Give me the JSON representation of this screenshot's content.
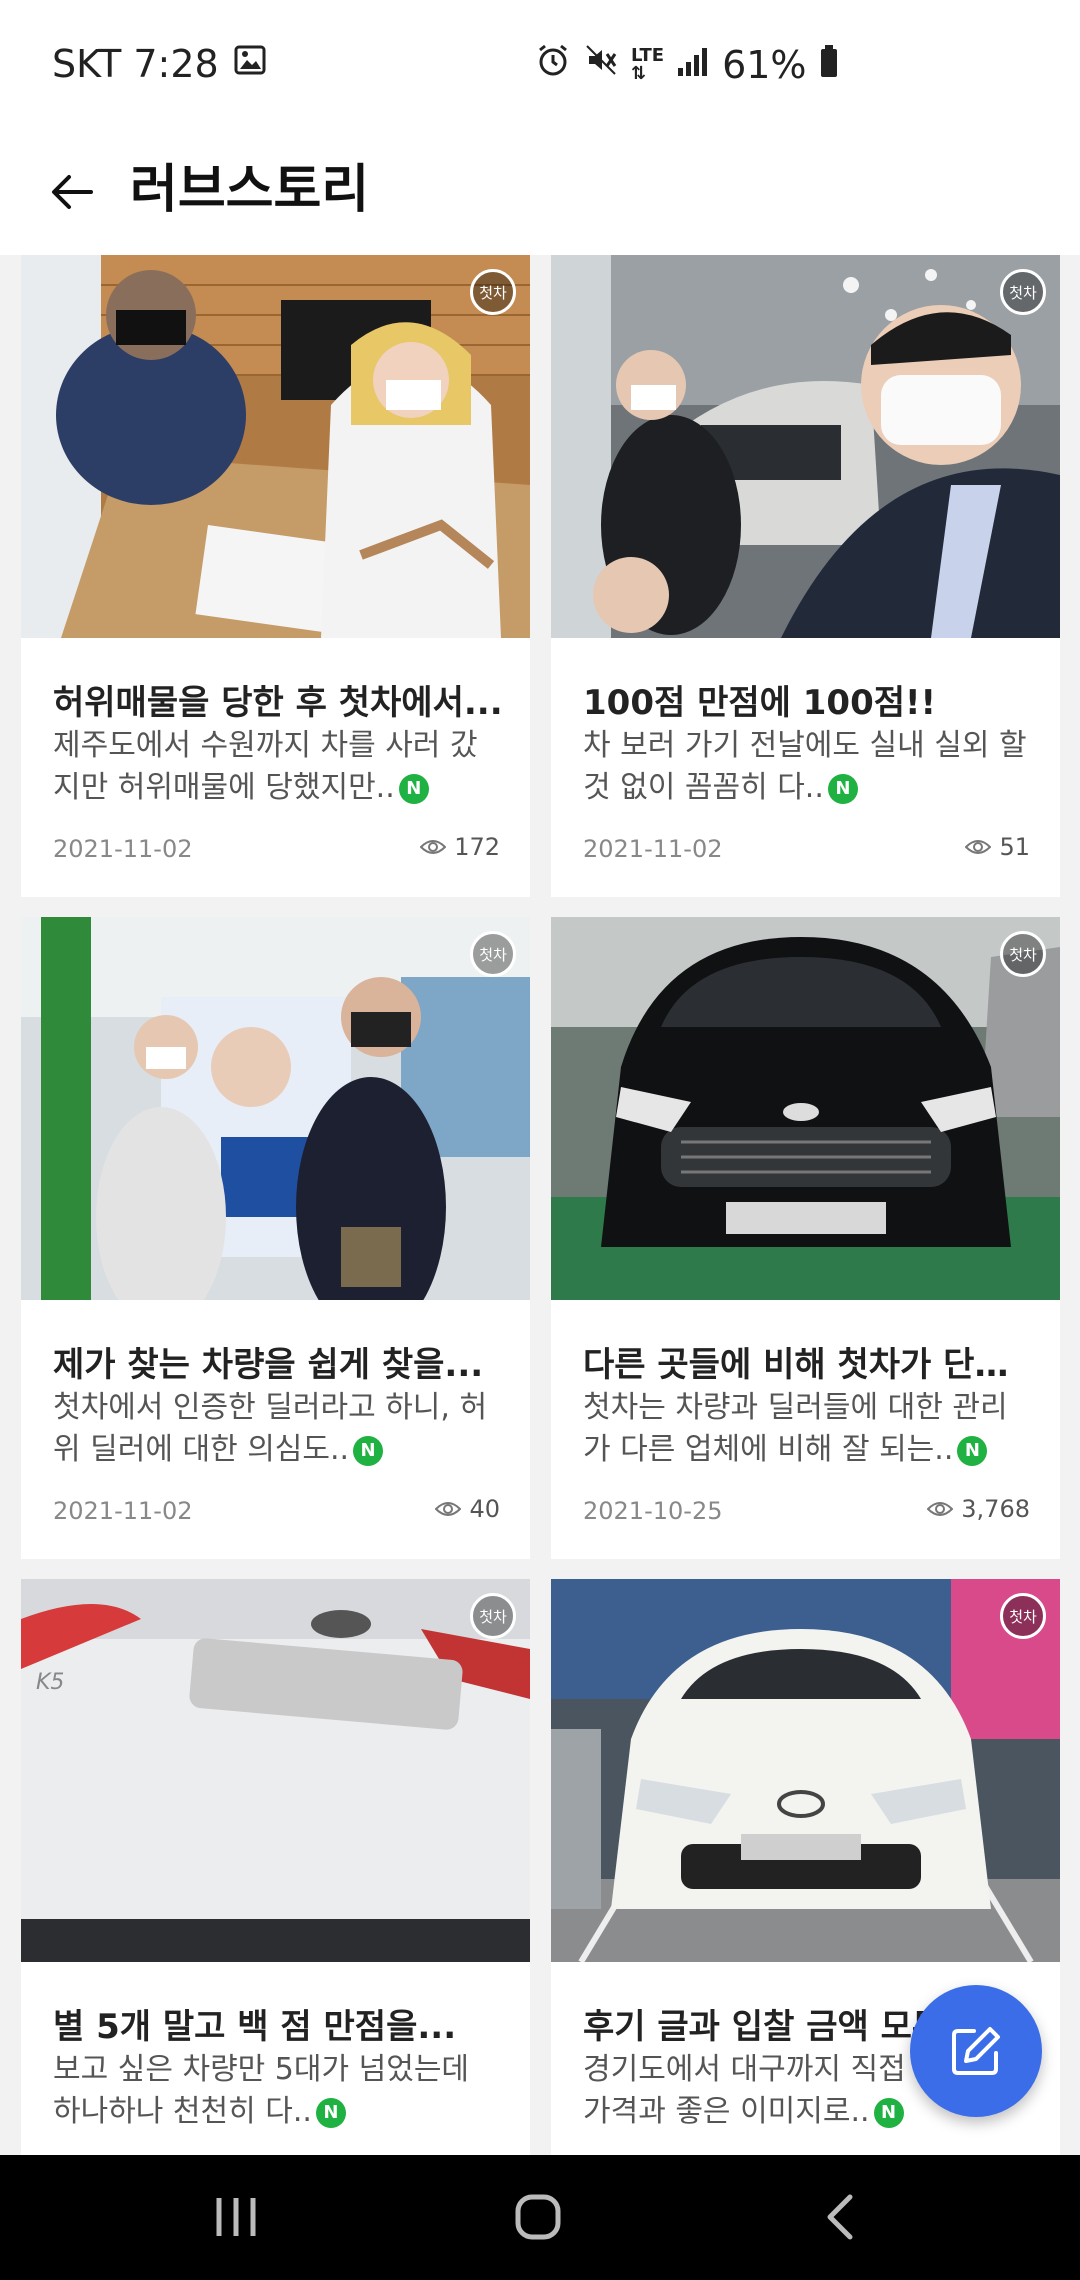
{
  "status_bar": {
    "carrier_time": "SKT 7:28",
    "network": "LTE",
    "battery": "61%",
    "icons": [
      "gallery-icon",
      "alarm-icon",
      "mute-icon",
      "signal-icon",
      "battery-icon"
    ]
  },
  "app_bar": {
    "title": "러브스토리",
    "back_icon": "arrow-left-icon"
  },
  "cards": [
    {
      "badge": "첫차",
      "title": "허위매물을 당한 후 첫차에서...",
      "desc": "제주도에서 수원까지 차를 사러 갔지만 허위매물에 당했지만..",
      "date": "2021-11-02",
      "views": "172"
    },
    {
      "badge": "첫차",
      "title": "100점 만점에 100점!!",
      "desc": "차 보러 가기 전날에도 실내 실외 할 것 없이 꼼꼼히 다..",
      "date": "2021-11-02",
      "views": "51"
    },
    {
      "badge": "첫차",
      "title": "제가 찾는 차량을 쉽게 찾을...",
      "desc": "첫차에서 인증한 딜러라고 하니, 허위 딜러에 대한 의심도..",
      "date": "2021-11-02",
      "views": "40"
    },
    {
      "badge": "첫차",
      "title": "다른 곳들에 비해 첫차가 단연...",
      "desc": "첫차는 차량과 딜러들에 대한 관리가 다른 업체에 비해 잘 되는..",
      "date": "2021-10-25",
      "views": "3,768"
    },
    {
      "badge": "첫차",
      "title": "별 5개 말고 백 점 만점을...",
      "desc": "보고 싶은 차량만 5대가 넘었는데 하나하나 천천히 다..",
      "date": "",
      "views": ""
    },
    {
      "badge": "첫차",
      "title": "후기 글과 입찰 금액 모두...",
      "desc": "경기도에서 대구까지 직접 가 좋은 가격과 좋은 이미지로..",
      "date": "",
      "views": ""
    }
  ],
  "new_marker": "N",
  "fab_icon": "edit-icon",
  "nav": {
    "recent_icon": "recent-apps-icon",
    "home_icon": "home-icon",
    "back_icon": "back-nav-icon"
  },
  "colors": {
    "accent": "#3b6de8",
    "new_badge": "#1fb141",
    "background": "#f2f2f2"
  }
}
